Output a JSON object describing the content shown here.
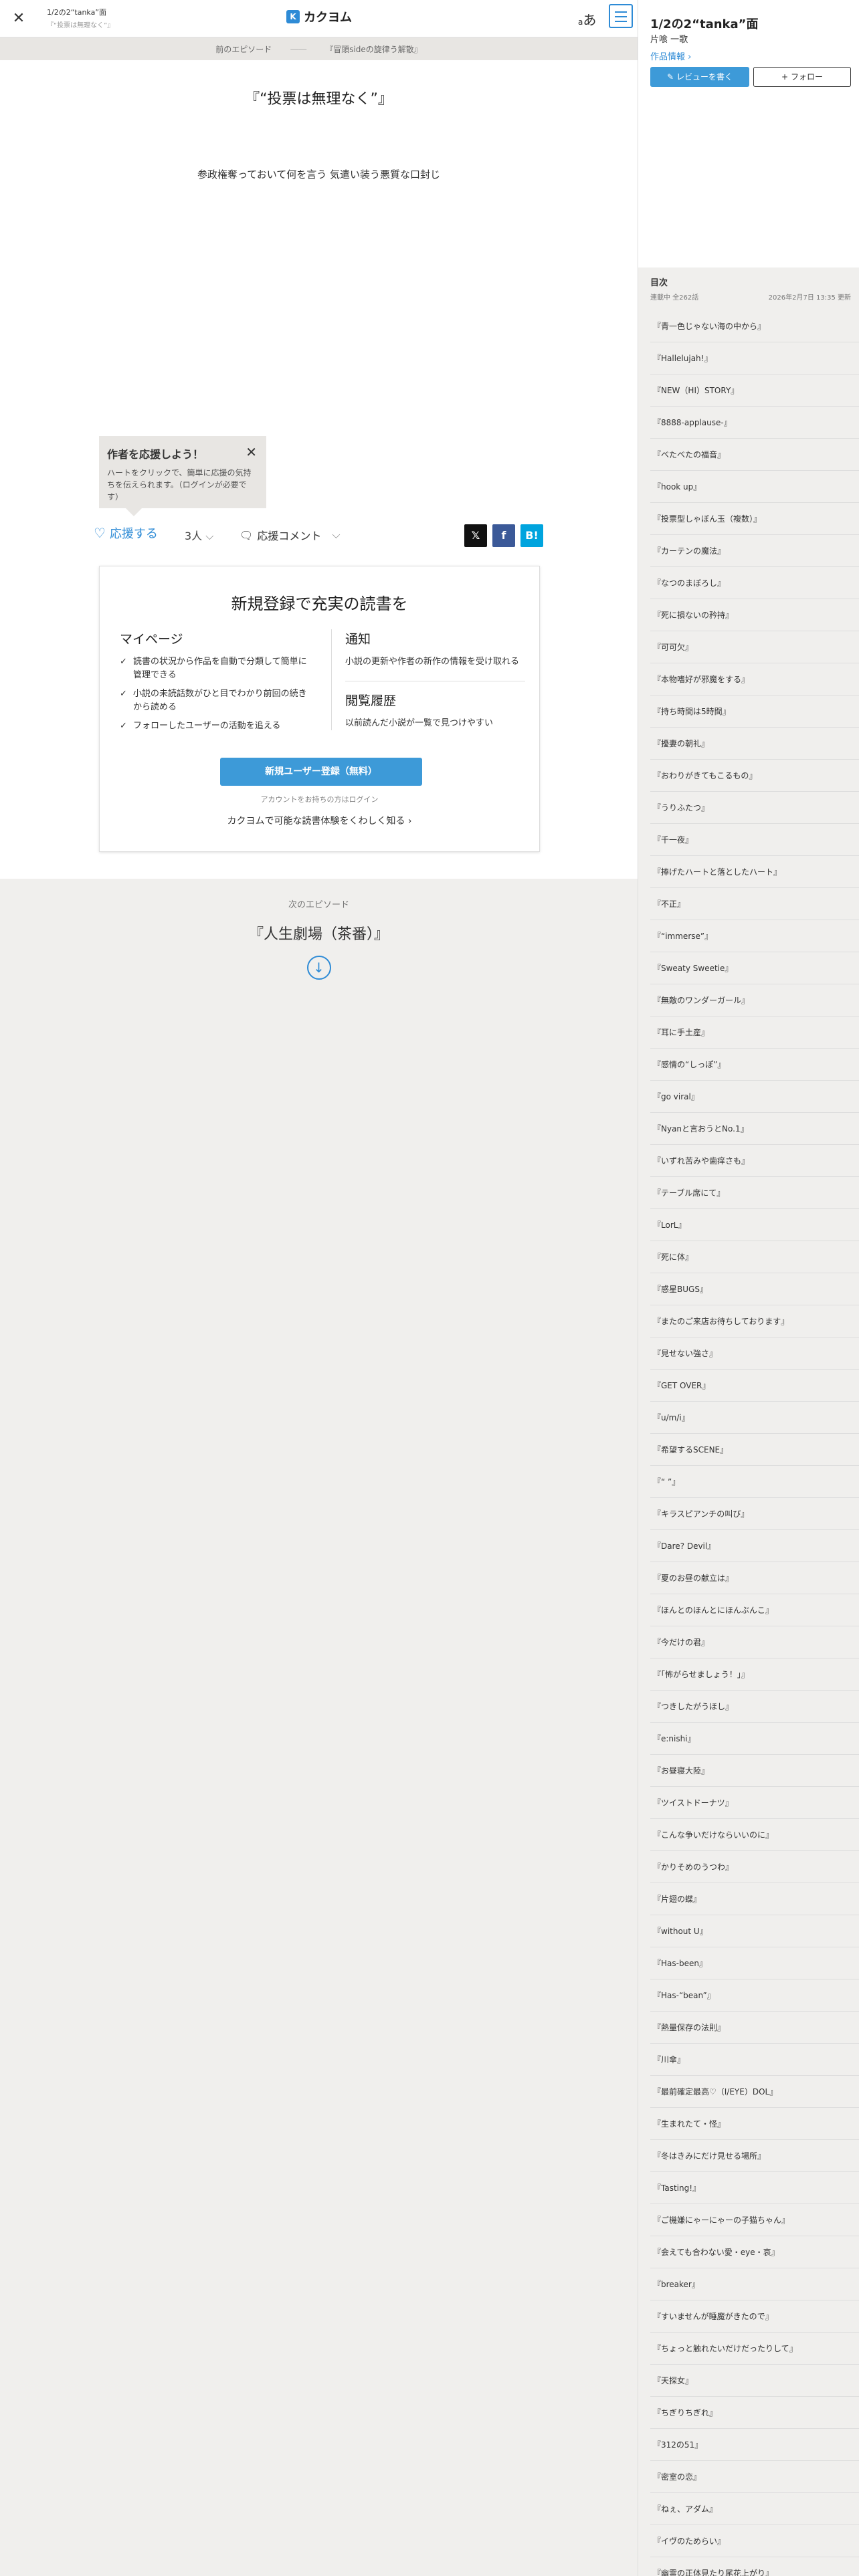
{
  "header": {
    "title": "1/2の2“tanka”面",
    "subtitle": "『“投票は無理なく”』",
    "logo": "カクヨム",
    "logo_mark": "K",
    "font_toggle": "あ"
  },
  "breadcrumb": {
    "prev": "前のエピソード",
    "sep": "――",
    "current": "『冒頭sideの旋律う解散』"
  },
  "episode": {
    "title": "『“投票は無理なく”』",
    "body": "参政権奪っておいて何を言う 気遣い装う悪質な口封じ"
  },
  "tooltip": {
    "title": "作者を応援しよう！",
    "body": "ハートをクリックで、簡単に応援の気持ちを伝えられます。（ログインが必要です）"
  },
  "actions": {
    "support_label": "応援する",
    "support_count": "3人",
    "comment_label": "応援コメント"
  },
  "register": {
    "heading": "新規登録で充実の読書を",
    "mypage_title": "マイページ",
    "mypage_items": [
      "読書の状況から作品を自動で分類して簡単に管理できる",
      "小説の未読話数がひと目でわかり前回の続きから読める",
      "フォローしたユーザーの活動を追える"
    ],
    "notify_title": "通知",
    "notify_desc": "小説の更新や作者の新作の情報を受け取れる",
    "history_title": "閲覧履歴",
    "history_desc": "以前読んだ小説が一覧で見つけやすい",
    "button": "新規ユーザー登録（無料）",
    "login": "アカウントをお持ちの方はログイン",
    "more": "カクヨムで可能な読書体験をくわしく知る"
  },
  "next": {
    "label": "次のエピソード",
    "title": "『人生劇場（茶番）』"
  },
  "panel": {
    "work_title": "1/2の2“tanka”面",
    "author": "片喰 一歌",
    "info": "作品情報",
    "review": "レビューを書く",
    "follow": "フォロー",
    "toc_title": "目次",
    "toc_status": "連載中 全262話",
    "toc_updated": "2026年2月7日 13:35 更新",
    "episodes": [
      "『青一色じゃない海の中から』",
      "『Hallelujah!』",
      "『NEW（HI）STORY』",
      "『8888-applause-』",
      "『べたべたの福音』",
      "『hook up』",
      "『投票型しゃぼん玉（複数）』",
      "『カーテンの魔法』",
      "『なつのまぼろし』",
      "『死に損ないの矜持』",
      "『可可欠』",
      "『本物嗜好が邪魔をする』",
      "『持ち時間は5時間』",
      "『擾妻の朝礼』",
      "『おわりがきてもこるもの』",
      "『うりふたつ』",
      "『千一夜』",
      "『捧げたハートと落としたハート』",
      "『不正』",
      "『“immerse”』",
      "『Sweaty Sweetie』",
      "『無敵のワンダーガール』",
      "『耳に手土産』",
      "『感情の“しっぽ”』",
      "『go viral』",
      "『Nyanと言おうとNo.1』",
      "『いずれ苦みや歯痒さも』",
      "『テーブル席にて』",
      "『LorL』",
      "『死に体』",
      "『惑星BUGS』",
      "『またのご来店お待ちしております』",
      "『見せない強さ』",
      "『GET OVER』",
      "『u/m/i』",
      "『希望するSCENE』",
      "『“ ”』",
      "『キラスピアンチの叫び』",
      "『Dare? Devil』",
      "『夏のお昼の献立は』",
      "『ほんとのほんとにほんぶんこ』",
      "『今だけの君』",
      "『「怖がらせましょう！」』",
      "『つきしたがうほし』",
      "『e:nishi』",
      "『お昼寝大陸』",
      "『ツイストドーナツ』",
      "『こんな争いだけならいいのに』",
      "『かりそめのうつわ』",
      "『片翅の蝶』",
      "『without U』",
      "『Has-been』",
      "『Has-“bean”』",
      "『熱量保存の法則』",
      "『川傘』",
      "『最前確定最高♡（I/EYE）DOL』",
      "『生まれたて・怪』",
      "『冬はきみにだけ見せる場所』",
      "『Tasting!』",
      "『ご機嫌にゃーにゃーの子猫ちゃん』",
      "『会えても合わない愛・eye・哀』",
      "『breaker』",
      "『すいませんが睡魔がきたので』",
      "『ちょっと触れたいだけだったりして』",
      "『天探女』",
      "『ちぎりちぎれ』",
      "『312の51』",
      "『密室の恋』",
      "『ねぇ、アダム』",
      "『イヴのためらい』",
      "『幽霊の正体見たり尾花上がり』"
    ]
  }
}
